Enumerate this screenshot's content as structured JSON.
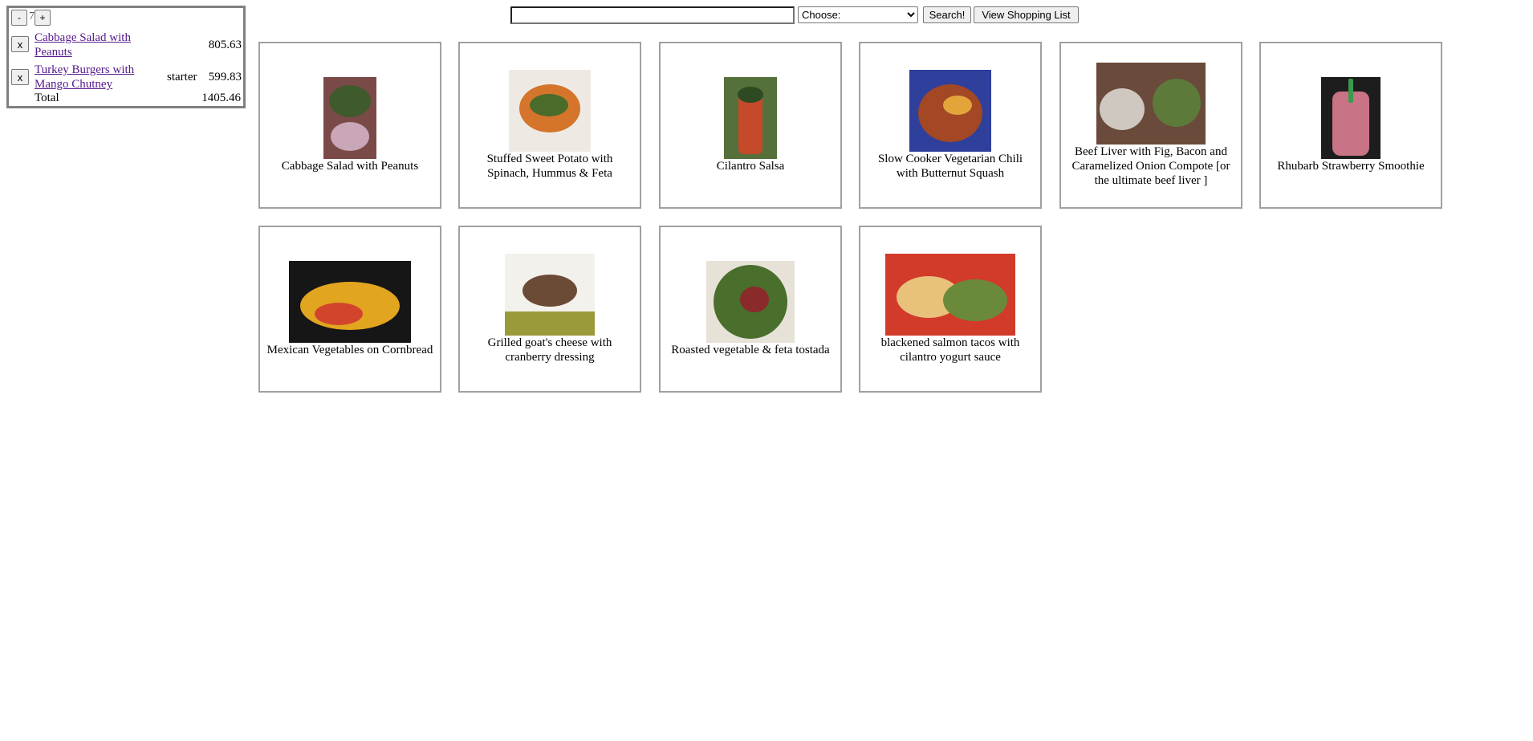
{
  "menu": {
    "guest_minus_label": "-",
    "guest_count": "7",
    "guest_plus_label": "+",
    "items": [
      {
        "remove_label": "x",
        "name": "Cabbage Salad with Peanuts",
        "course": "",
        "price": "805.63"
      },
      {
        "remove_label": "x",
        "name": "Turkey Burgers with Mango Chutney",
        "course": "starter",
        "price": "599.83"
      }
    ],
    "total_label": "Total",
    "total_value": "1405.46"
  },
  "toolbar": {
    "search_value": "",
    "category_selected": "Choose:",
    "search_button_label": "Search!",
    "shopping_list_button_label": "View Shopping List"
  },
  "recipes": [
    {
      "title": "Cabbage Salad with Peanuts",
      "colors": [
        "#7a4a48",
        "#3f5a2c",
        "#c9a6b8"
      ]
    },
    {
      "title": "Stuffed Sweet Potato with Spinach, Hummus & Feta",
      "colors": [
        "#efe9e3",
        "#d4752b",
        "#4b6b2a"
      ]
    },
    {
      "title": "Cilantro Salsa",
      "colors": [
        "#56703b",
        "#c44a2a",
        "#2d4a22"
      ]
    },
    {
      "title": "Slow Cooker Vegetarian Chili with Butternut Squash",
      "colors": [
        "#2e3f9c",
        "#a34724",
        "#e3a53a"
      ]
    },
    {
      "title": "Beef Liver with Fig, Bacon and Caramelized Onion Compote [or the ultimate beef liver ]",
      "colors": [
        "#6a4a3a",
        "#cfc8c0",
        "#5d7a3a"
      ]
    },
    {
      "title": "Rhubarb Strawberry Smoothie",
      "colors": [
        "#1d1d1d",
        "#c87386",
        "#3a9a4e"
      ]
    },
    {
      "title": "Mexican Vegetables on Cornbread",
      "colors": [
        "#161616",
        "#e2a51f",
        "#d2452c"
      ]
    },
    {
      "title": "Grilled goat's cheese with cranberry dressing",
      "colors": [
        "#f3f1ec",
        "#6b4a36",
        "#9a9a3a"
      ]
    },
    {
      "title": "Roasted vegetable & feta tostada",
      "colors": [
        "#e7e2d8",
        "#4a6e2c",
        "#8a2a2a"
      ]
    },
    {
      "title": "blackened salmon tacos with cilantro yogurt sauce",
      "colors": [
        "#d23a2a",
        "#e8c27a",
        "#6a8a3a"
      ]
    }
  ]
}
